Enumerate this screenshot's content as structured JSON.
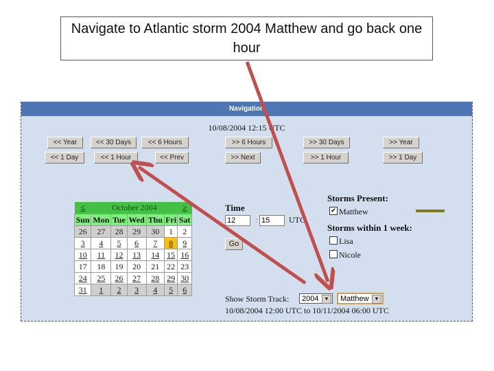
{
  "instruction": "Navigate to Atlantic storm 2004 Matthew and go back one hour",
  "panel": {
    "title": "Navigation",
    "current_datetime": "10/08/2004 12:15 UTC"
  },
  "nav_buttons": {
    "row1": [
      "<< Year",
      "<< 30 Days",
      "<< 6 Hours",
      ">> 6 Hours",
      ">> 30 Days",
      ">> Year"
    ],
    "row2": [
      "<< 1 Day",
      "<< 1 Hour",
      "<< Prev",
      ">> Next",
      ">> 1 Hour",
      ">> 1 Day"
    ]
  },
  "calendar": {
    "prev": "≤",
    "next": "≥",
    "month_label": "October 2004",
    "weekdays": [
      "Sun",
      "Mon",
      "Tue",
      "Wed",
      "Thu",
      "Fri",
      "Sat"
    ],
    "weeks": [
      [
        "26",
        "27",
        "28",
        "29",
        "30",
        "1",
        "2"
      ],
      [
        "3",
        "4",
        "5",
        "6",
        "7",
        "8",
        "9"
      ],
      [
        "10",
        "11",
        "12",
        "13",
        "14",
        "15",
        "16"
      ],
      [
        "17",
        "18",
        "19",
        "20",
        "21",
        "22",
        "23"
      ],
      [
        "24",
        "25",
        "26",
        "27",
        "28",
        "29",
        "30"
      ],
      [
        "31",
        "1",
        "2",
        "3",
        "4",
        "5",
        "6"
      ]
    ],
    "selected_day": "8"
  },
  "time_form": {
    "label": "Time",
    "hour": "12",
    "separator": ":",
    "minute": "15",
    "tz": "UTC",
    "go_label": "Go"
  },
  "storms": {
    "present_label": "Storms Present:",
    "present": [
      {
        "name": "Matthew",
        "checked": true,
        "track_color": "#807a1c"
      }
    ],
    "week_label": "Storms within 1 week:",
    "week": [
      {
        "name": "Lisa",
        "checked": false
      },
      {
        "name": "Nicole",
        "checked": false
      }
    ]
  },
  "track": {
    "label": "Show Storm Track:",
    "year": "2004",
    "storm": "Matthew",
    "range": "10/08/2004 12:00 UTC to 10/11/2004 06:00 UTC"
  },
  "colors": {
    "header": "#4d76b2",
    "panel_bg": "#d3deee",
    "arrow": "#c0504d",
    "selected_day": "#f6c10e"
  }
}
